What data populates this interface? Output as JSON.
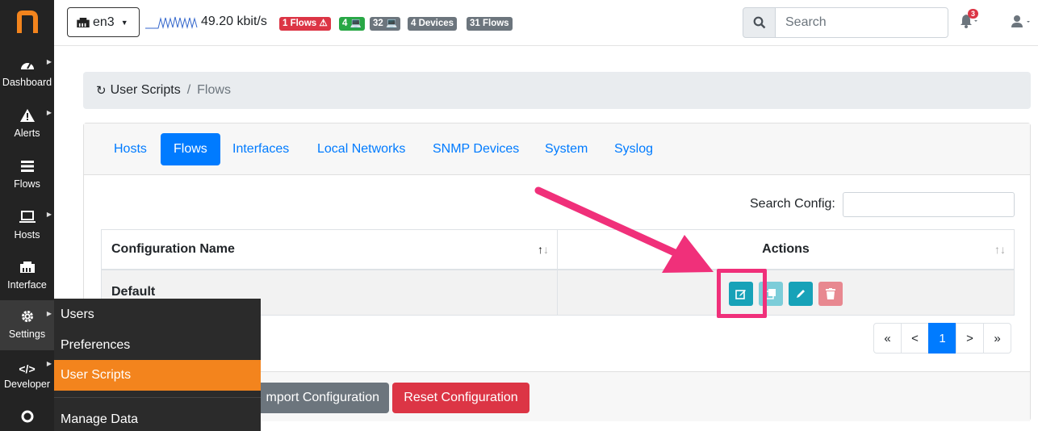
{
  "sidebar": {
    "items": [
      {
        "label": "Dashboard",
        "icon": "gauge-icon"
      },
      {
        "label": "Alerts",
        "icon": "warning-icon"
      },
      {
        "label": "Flows",
        "icon": "list-icon"
      },
      {
        "label": "Hosts",
        "icon": "laptop-icon"
      },
      {
        "label": "Interface",
        "icon": "ethernet-icon"
      },
      {
        "label": "Settings",
        "icon": "gear-icon"
      },
      {
        "label": "Developer",
        "icon": "code-icon"
      }
    ]
  },
  "topbar": {
    "interface": "en3",
    "throughput": "49.20 kbit/s",
    "badges": {
      "flow_alerts": "1 Flows",
      "local_hosts": "4",
      "remote_hosts": "32",
      "devices": "4 Devices",
      "flows": "31 Flows"
    },
    "search_placeholder": "Search",
    "notification_count": "3"
  },
  "breadcrumb": {
    "root": "User Scripts",
    "current": "Flows"
  },
  "tabs": [
    {
      "label": "Hosts",
      "active": false
    },
    {
      "label": "Flows",
      "active": true
    },
    {
      "label": "Interfaces",
      "active": false
    },
    {
      "label": "Local Networks",
      "active": false
    },
    {
      "label": "SNMP Devices",
      "active": false
    },
    {
      "label": "System",
      "active": false
    },
    {
      "label": "Syslog",
      "active": false
    }
  ],
  "search_config": {
    "label": "Search Config:",
    "value": ""
  },
  "table": {
    "headers": [
      "Configuration Name",
      "Actions"
    ],
    "rows": [
      {
        "name": "Default"
      }
    ]
  },
  "pagination": {
    "first": "«",
    "prev": "<",
    "current": "1",
    "next": ">",
    "last": "»"
  },
  "footer": {
    "import_label": "Import Configuration",
    "import_visible_label": "mport Configuration",
    "reset_label": "Reset Configuration"
  },
  "settings_menu": {
    "items": [
      "Users",
      "Preferences",
      "User Scripts",
      "Manage Data"
    ],
    "active": "User Scripts"
  },
  "colors": {
    "brand_orange": "#f3841d",
    "primary": "#007bff",
    "danger": "#dc3545",
    "info": "#17a2b8",
    "annotation_pink": "#f0307a"
  }
}
